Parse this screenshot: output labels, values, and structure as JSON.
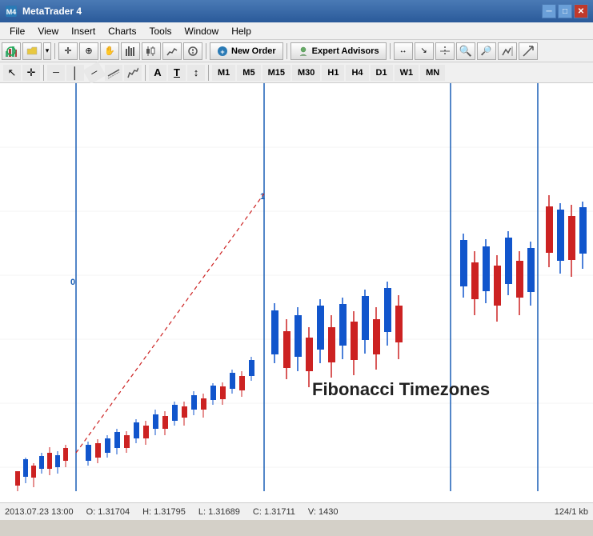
{
  "titleBar": {
    "title": "MetaTrader 4",
    "icon": "mt4-icon"
  },
  "menuBar": {
    "items": [
      "File",
      "View",
      "Insert",
      "Charts",
      "Tools",
      "Window",
      "Help"
    ]
  },
  "toolbar1": {
    "newOrderLabel": "New Order",
    "expertAdvisorsLabel": "Expert Advisors"
  },
  "timeframes": {
    "buttons": [
      "M1",
      "M5",
      "M15",
      "M30",
      "H1",
      "H4",
      "D1",
      "W1",
      "MN"
    ]
  },
  "chart": {
    "title": "Fibonacci Timezones",
    "label0": "0",
    "label1": "1"
  },
  "statusBar": {
    "datetime": "2013.07.23 13:00",
    "open": "O: 1.31704",
    "high": "H: 1.31795",
    "low": "L: 1.31689",
    "close": "C: 1.31711",
    "volume": "V: 1430",
    "info": "124/1 kb"
  }
}
